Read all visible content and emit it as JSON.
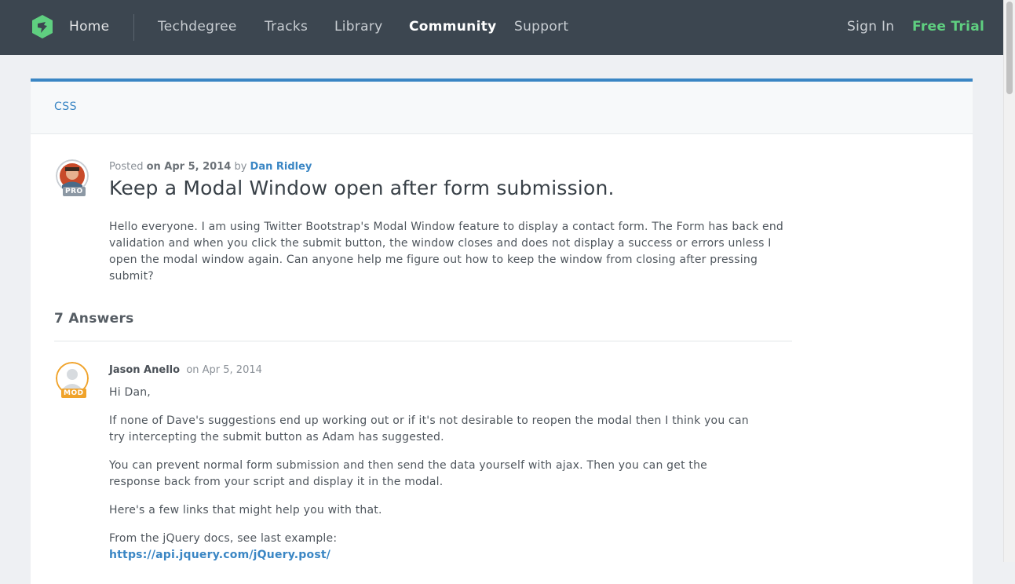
{
  "nav": {
    "home": "Home",
    "items": [
      "Techdegree",
      "Tracks",
      "Library",
      "Community",
      "Support"
    ],
    "sign_in": "Sign In",
    "free_trial": "Free Trial"
  },
  "breadcrumb": "CSS",
  "question": {
    "posted_prefix": "Posted",
    "posted_on": "on Apr 5, 2014",
    "by": "by",
    "author": "Dan Ridley",
    "badge": "PRO",
    "title": "Keep a Modal Window open after form submission.",
    "body": "Hello everyone. I am using Twitter Bootstrap's Modal Window feature to display a contact form. The Form has back end validation and when you click the submit button, the window closes and does not display a success or errors unless I open the modal window again. Can anyone help me figure out how to keep the window from closing after pressing submit?"
  },
  "answers": {
    "heading": "7 Answers",
    "first": {
      "author": "Jason Anello",
      "date": "on Apr 5, 2014",
      "badge": "MOD",
      "greeting": "Hi Dan,",
      "p1": "If none of Dave's suggestions end up working out or if it's not desirable to reopen the modal then I think you can try intercepting the submit button as Adam has suggested.",
      "p2": "You can prevent normal form submission and then send the data yourself with ajax. Then you can get the response back from your script and display it in the modal.",
      "p3": "Here's a few links that might help you with that.",
      "p4": "From the jQuery docs, see last example:",
      "link": "https://api.jquery.com/jQuery.post/"
    }
  },
  "colors": {
    "nav_bg": "#3c4650",
    "accent": "#3a86c4",
    "trial": "#5fcf80",
    "mod_badge": "#f0a32b",
    "pro_badge": "#8c98a4"
  }
}
